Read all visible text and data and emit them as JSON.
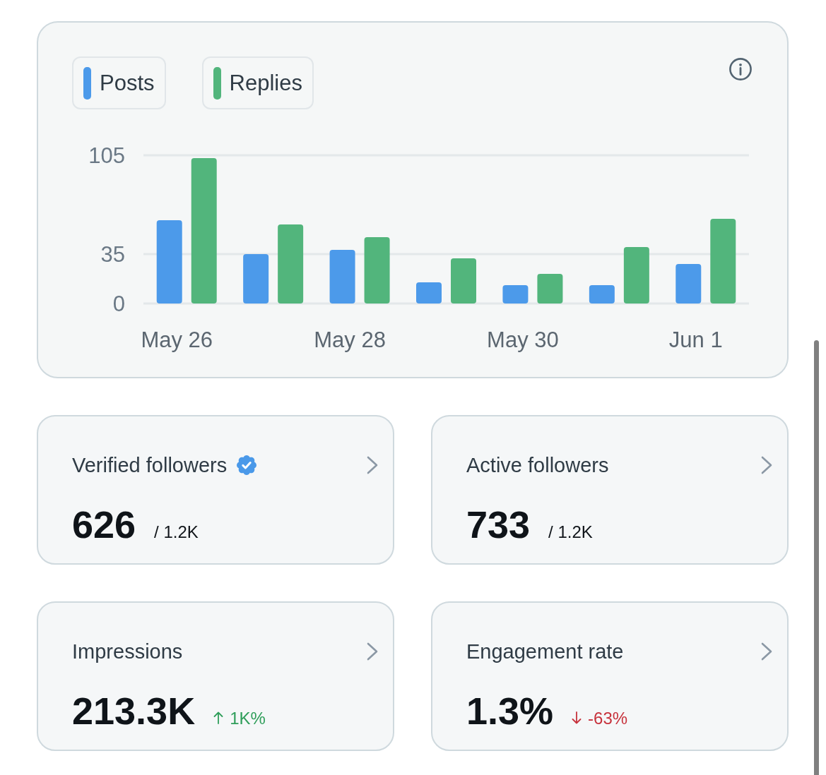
{
  "chart": {
    "chart_data": {
      "type": "bar",
      "categories": [
        "May 26",
        null,
        "May 28",
        null,
        "May 30",
        null,
        "Jun 1"
      ],
      "yticks": [
        0,
        35,
        105
      ],
      "ylim": [
        0,
        105
      ],
      "series": [
        {
          "name": "Posts",
          "color": "#4c9aea",
          "values": [
            59,
            35,
            38,
            15,
            13,
            13,
            28
          ]
        },
        {
          "name": "Replies",
          "color": "#52b57c",
          "values": [
            103,
            56,
            47,
            32,
            21,
            40,
            60
          ]
        }
      ]
    }
  },
  "stats": [
    {
      "kind": "ratio",
      "title": "Verified followers",
      "verified": true,
      "value": "626",
      "total": "/ 1.2K"
    },
    {
      "kind": "ratio",
      "title": "Active followers",
      "verified": false,
      "value": "733",
      "total": "/ 1.2K"
    },
    {
      "kind": "trend",
      "title": "Impressions",
      "verified": false,
      "value": "213.3K",
      "change": {
        "kind": "increase",
        "text": "1K%"
      }
    },
    {
      "kind": "trend",
      "title": "Engagement rate",
      "verified": false,
      "value": "1.3%",
      "change": {
        "kind": "decrease",
        "text": "-63%"
      }
    }
  ]
}
